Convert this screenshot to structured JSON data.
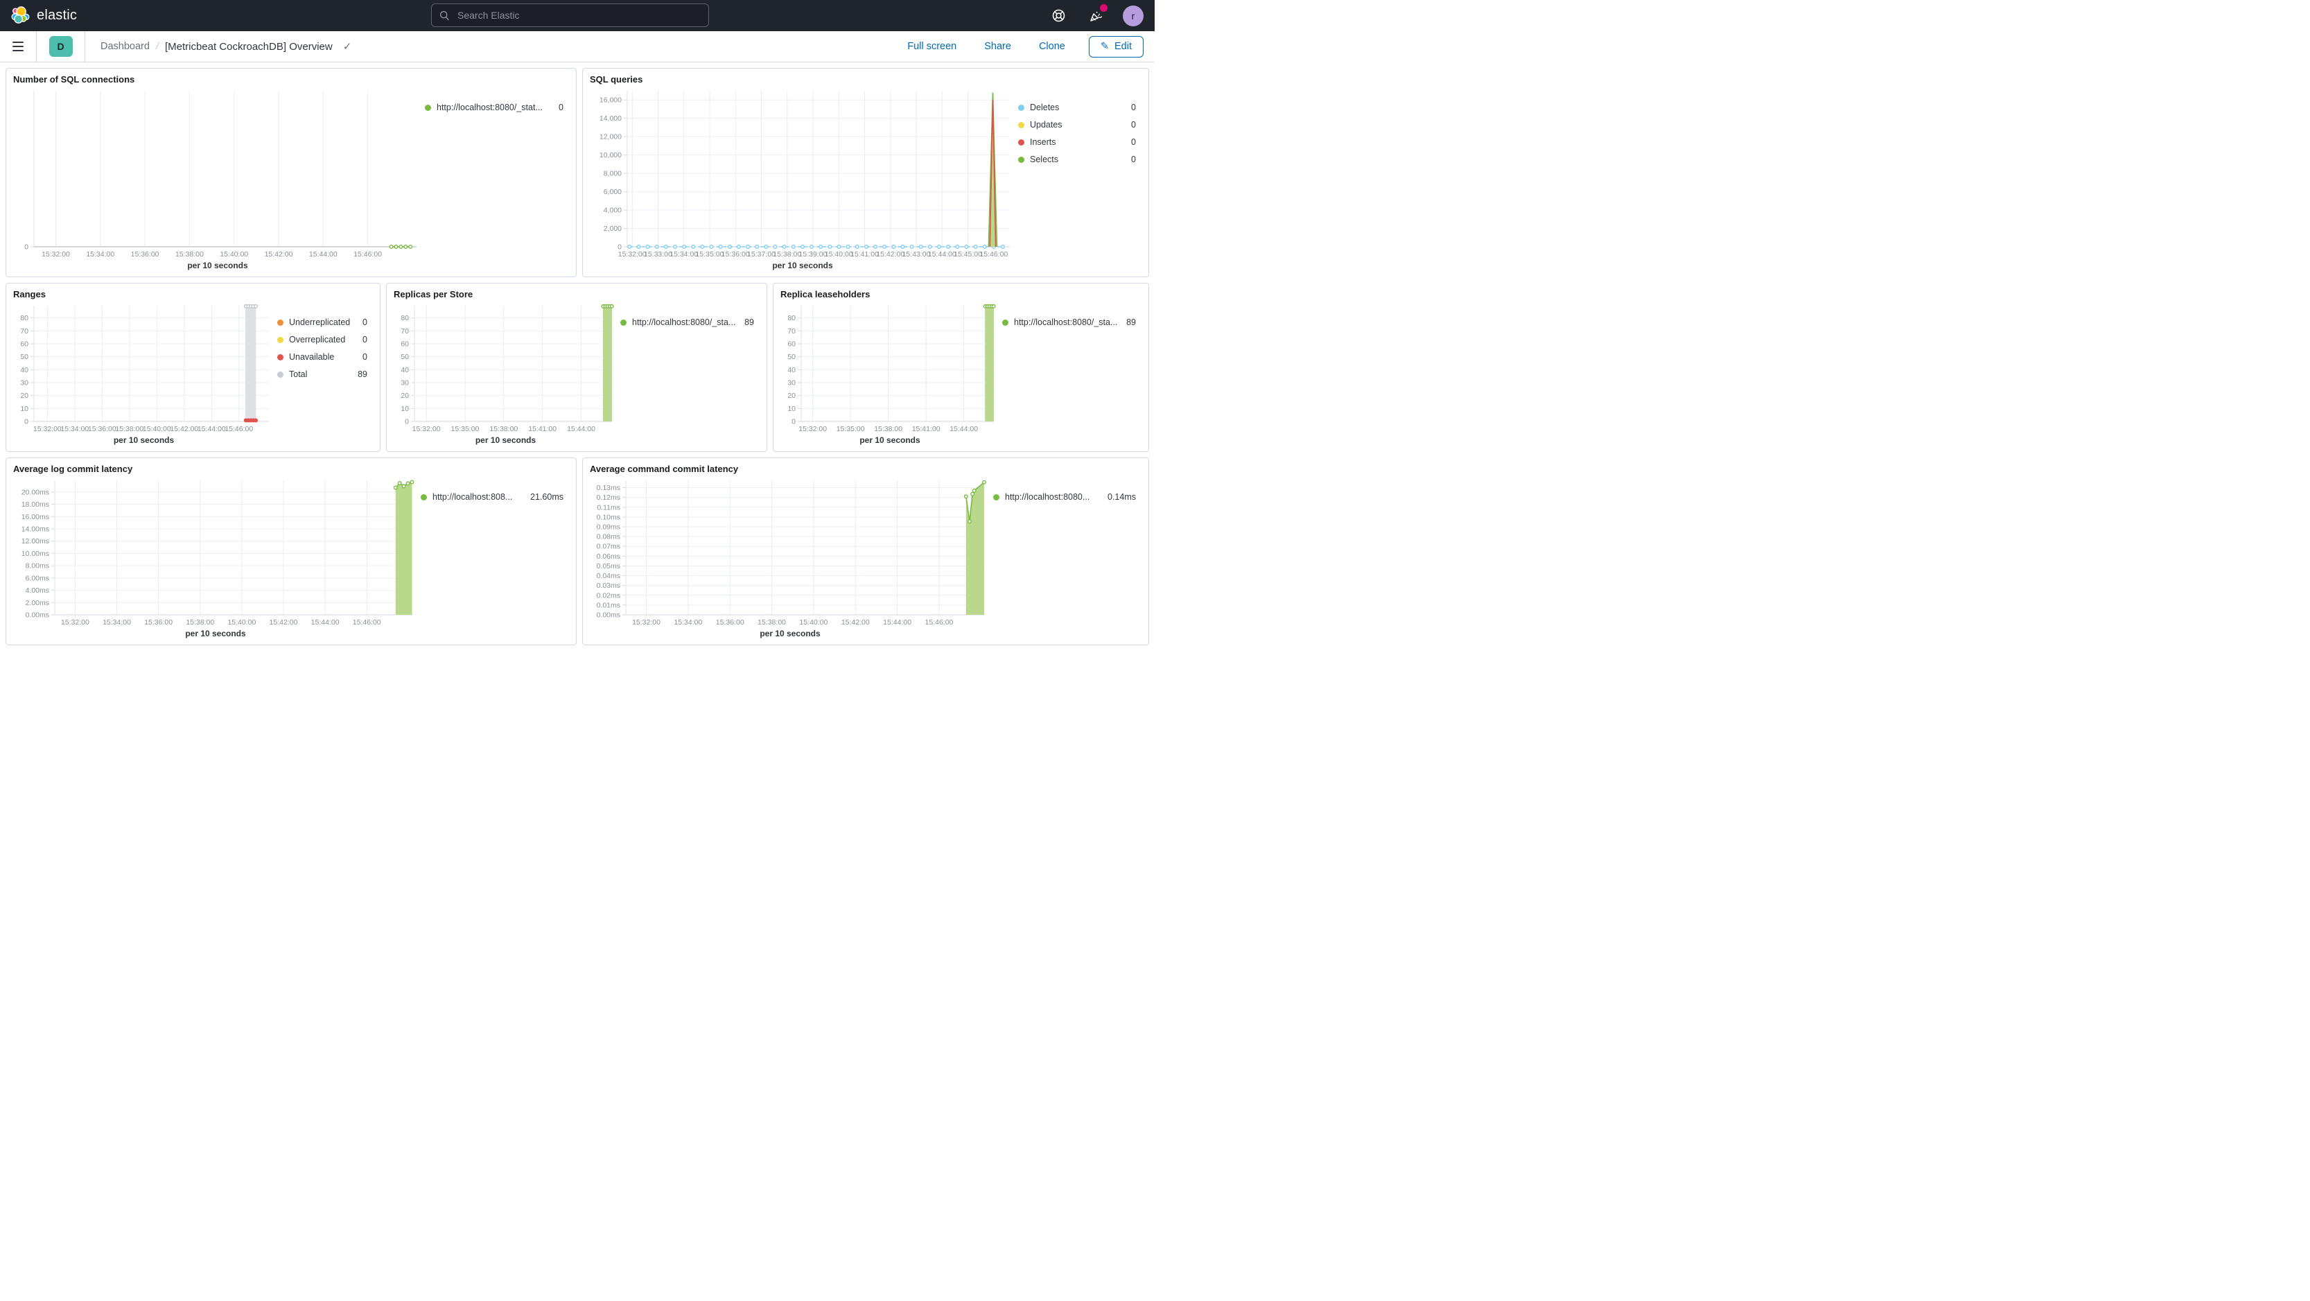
{
  "header": {
    "logo_text": "elastic",
    "search_placeholder": "Search Elastic",
    "avatar_initial": "r"
  },
  "toolbar": {
    "badge": "D",
    "breadcrumb_root": "Dashboard",
    "breadcrumb_sep": "/",
    "title": "[Metricbeat CockroachDB] Overview",
    "actions": [
      {
        "label": "Full screen"
      },
      {
        "label": "Share"
      },
      {
        "label": "Clone"
      }
    ],
    "edit_label": "Edit",
    "edit_icon": "✎",
    "title_check": "✓"
  },
  "colors": {
    "green": "#77BB41",
    "green_fill": "#B9D88C",
    "blue": "#7FCDF2",
    "yellow": "#F0D843",
    "red": "#E0524C",
    "orange": "#EF8E38",
    "grey_bar": "#DEE0E4",
    "link_blue": "#006bb4"
  },
  "panels": [
    {
      "title": "Number of SQL connections",
      "caption": "per 10 seconds",
      "legend": [
        {
          "color": "#77BB41",
          "label": "http://localhost:8080/_stat...",
          "value": "0"
        }
      ],
      "chart": {
        "ylim": [
          0,
          1
        ],
        "baseline": 2,
        "yticks": [
          {
            "v": 0,
            "label": "0"
          }
        ],
        "xticks": [
          {
            "f": 0.057,
            "label": "15:32:00"
          },
          {
            "f": 0.1735,
            "label": "15:34:00"
          },
          {
            "f": 0.29,
            "label": "15:36:00"
          },
          {
            "f": 0.4065,
            "label": "15:38:00"
          },
          {
            "f": 0.523,
            "label": "15:40:00"
          },
          {
            "f": 0.6395,
            "label": "15:42:00"
          },
          {
            "f": 0.756,
            "label": "15:44:00"
          },
          {
            "f": 0.8725,
            "label": "15:46:00"
          }
        ],
        "series": [
          {
            "type": "line",
            "color": "#77BB41",
            "markers": "hollow",
            "points": [
              [
                0.934,
                0
              ],
              [
                0.9465,
                0
              ],
              [
                0.959,
                0
              ],
              [
                0.9715,
                0
              ],
              [
                0.984,
                0
              ]
            ]
          }
        ]
      }
    },
    {
      "title": "SQL queries",
      "caption": "per 10 seconds",
      "legend": [
        {
          "color": "#7FCDF2",
          "label": "Deletes",
          "value": "0"
        },
        {
          "color": "#F0D843",
          "label": "Updates",
          "value": "0"
        },
        {
          "color": "#E0524C",
          "label": "Inserts",
          "value": "0"
        },
        {
          "color": "#77BB41",
          "label": "Selects",
          "value": "0"
        }
      ],
      "chart": {
        "ylim": [
          0,
          17000
        ],
        "yticks": [
          {
            "v": 0,
            "label": "0"
          },
          {
            "v": 2000,
            "label": "2,000"
          },
          {
            "v": 4000,
            "label": "4,000"
          },
          {
            "v": 6000,
            "label": "6,000"
          },
          {
            "v": 8000,
            "label": "8,000"
          },
          {
            "v": 10000,
            "label": "10,000"
          },
          {
            "v": 12000,
            "label": "12,000"
          },
          {
            "v": 14000,
            "label": "14,000"
          },
          {
            "v": 16000,
            "label": "16,000"
          }
        ],
        "xticks": [
          {
            "f": 0.013,
            "label": "15:32:00"
          },
          {
            "f": 0.0805,
            "label": "15:33:00"
          },
          {
            "f": 0.148,
            "label": "15:34:00"
          },
          {
            "f": 0.2155,
            "label": "15:35:00"
          },
          {
            "f": 0.283,
            "label": "15:36:00"
          },
          {
            "f": 0.3505,
            "label": "15:37:00"
          },
          {
            "f": 0.418,
            "label": "15:38:00"
          },
          {
            "f": 0.4855,
            "label": "15:39:00"
          },
          {
            "f": 0.553,
            "label": "15:40:00"
          },
          {
            "f": 0.6205,
            "label": "15:41:00"
          },
          {
            "f": 0.688,
            "label": "15:42:00"
          },
          {
            "f": 0.7555,
            "label": "15:43:00"
          },
          {
            "f": 0.823,
            "label": "15:44:00"
          },
          {
            "f": 0.8905,
            "label": "15:45:00"
          },
          {
            "f": 0.958,
            "label": "15:46:00"
          }
        ],
        "series": [
          {
            "type": "hline",
            "y": 0,
            "from": 0.006,
            "to": 0.985,
            "color": "#7FCDF2",
            "dashed": true,
            "markers": "hollow",
            "marker_step": 0.0238
          },
          {
            "type": "line",
            "color": "#77BB41",
            "fill": "#B9D88C",
            "points": [
              [
                0.9445,
                0
              ],
              [
                0.9555,
                16800
              ],
              [
                0.9665,
                0
              ]
            ]
          },
          {
            "type": "line",
            "color": "#E0524C",
            "points": [
              [
                0.948,
                0
              ],
              [
                0.9555,
                16000
              ],
              [
                0.963,
                0
              ]
            ]
          }
        ]
      }
    },
    {
      "title": "Ranges",
      "caption": "per 10 seconds",
      "legend": [
        {
          "color": "#EF8E38",
          "label": "Underreplicated",
          "value": "0"
        },
        {
          "color": "#F0D843",
          "label": "Overreplicated",
          "value": "0"
        },
        {
          "color": "#E0524C",
          "label": "Unavailable",
          "value": "0"
        },
        {
          "color": "#C9CDD3",
          "label": "Total",
          "value": "89"
        }
      ],
      "chart": {
        "ylim": [
          0,
          89.5
        ],
        "yticks": [
          {
            "v": 0,
            "label": "0"
          },
          {
            "v": 10,
            "label": "10"
          },
          {
            "v": 20,
            "label": "20"
          },
          {
            "v": 30,
            "label": "30"
          },
          {
            "v": 40,
            "label": "40"
          },
          {
            "v": 50,
            "label": "50"
          },
          {
            "v": 60,
            "label": "60"
          },
          {
            "v": 70,
            "label": "70"
          },
          {
            "v": 80,
            "label": "80"
          }
        ],
        "xticks": [
          {
            "f": 0.057,
            "label": "15:32:00"
          },
          {
            "f": 0.1735,
            "label": "15:34:00"
          },
          {
            "f": 0.29,
            "label": "15:36:00"
          },
          {
            "f": 0.4065,
            "label": "15:38:00"
          },
          {
            "f": 0.523,
            "label": "15:40:00"
          },
          {
            "f": 0.6395,
            "label": "15:42:00"
          },
          {
            "f": 0.756,
            "label": "15:44:00"
          },
          {
            "f": 0.8725,
            "label": "15:46:00"
          }
        ],
        "series": [
          {
            "type": "bar",
            "x0": 0.9,
            "x1": 0.945,
            "v": 89,
            "color": "#DEE0E4"
          },
          {
            "type": "markers",
            "marker": "hollow",
            "color": "#c2c5cb",
            "points": [
              [
                0.902,
                89
              ],
              [
                0.9125,
                89
              ],
              [
                0.923,
                89
              ],
              [
                0.9335,
                89
              ],
              [
                0.944,
                89
              ]
            ]
          },
          {
            "type": "markers",
            "marker": "filled",
            "color": "#E0524C",
            "points": [
              [
                0.902,
                0.8
              ],
              [
                0.9125,
                0.8
              ],
              [
                0.923,
                0.8
              ],
              [
                0.9335,
                0.8
              ],
              [
                0.944,
                0.8
              ]
            ]
          }
        ]
      }
    },
    {
      "title": "Replicas per Store",
      "caption": "per 10 seconds",
      "legend": [
        {
          "color": "#77BB41",
          "label": "http://localhost:8080/_sta...",
          "value": "89"
        }
      ],
      "chart": {
        "ylim": [
          0,
          89.5
        ],
        "yticks": [
          {
            "v": 0,
            "label": "0"
          },
          {
            "v": 10,
            "label": "10"
          },
          {
            "v": 20,
            "label": "20"
          },
          {
            "v": 30,
            "label": "30"
          },
          {
            "v": 40,
            "label": "40"
          },
          {
            "v": 50,
            "label": "50"
          },
          {
            "v": 60,
            "label": "60"
          },
          {
            "v": 70,
            "label": "70"
          },
          {
            "v": 80,
            "label": "80"
          }
        ],
        "xticks": [
          {
            "f": 0.06,
            "label": "15:32:00"
          },
          {
            "f": 0.256,
            "label": "15:35:00"
          },
          {
            "f": 0.452,
            "label": "15:38:00"
          },
          {
            "f": 0.648,
            "label": "15:41:00"
          },
          {
            "f": 0.844,
            "label": "15:44:00"
          }
        ],
        "series": [
          {
            "type": "line",
            "color": "#B9D88C",
            "fill": "#B9D88C",
            "points": [
              [
                0.954,
                89
              ],
              [
                1,
                89
              ]
            ]
          },
          {
            "type": "markers",
            "marker": "hollow",
            "color": "#77BB41",
            "points": [
              [
                0.956,
                89
              ],
              [
                0.967,
                89
              ],
              [
                0.978,
                89
              ],
              [
                0.989,
                89
              ],
              [
                0.999,
                89
              ]
            ]
          }
        ]
      }
    },
    {
      "title": "Replica leaseholders",
      "caption": "per 10 seconds",
      "legend": [
        {
          "color": "#77BB41",
          "label": "http://localhost:8080/_sta...",
          "value": "89"
        }
      ],
      "chart": {
        "ylim": [
          0,
          89.5
        ],
        "yticks": [
          {
            "v": 0,
            "label": "0"
          },
          {
            "v": 10,
            "label": "10"
          },
          {
            "v": 20,
            "label": "20"
          },
          {
            "v": 30,
            "label": "30"
          },
          {
            "v": 40,
            "label": "40"
          },
          {
            "v": 50,
            "label": "50"
          },
          {
            "v": 60,
            "label": "60"
          },
          {
            "v": 70,
            "label": "70"
          },
          {
            "v": 80,
            "label": "80"
          }
        ],
        "xticks": [
          {
            "f": 0.06,
            "label": "15:32:00"
          },
          {
            "f": 0.256,
            "label": "15:35:00"
          },
          {
            "f": 0.452,
            "label": "15:38:00"
          },
          {
            "f": 0.648,
            "label": "15:41:00"
          },
          {
            "f": 0.844,
            "label": "15:44:00"
          }
        ],
        "series": [
          {
            "type": "line",
            "color": "#B9D88C",
            "fill": "#B9D88C",
            "points": [
              [
                0.954,
                89
              ],
              [
                1,
                89
              ]
            ]
          },
          {
            "type": "markers",
            "marker": "hollow",
            "color": "#77BB41",
            "points": [
              [
                0.956,
                89
              ],
              [
                0.967,
                89
              ],
              [
                0.978,
                89
              ],
              [
                0.989,
                89
              ],
              [
                0.999,
                89
              ]
            ]
          }
        ]
      }
    },
    {
      "title": "Average log commit latency",
      "caption": "per 10 seconds",
      "legend": [
        {
          "color": "#77BB41",
          "label": "http://localhost:808...",
          "value": "21.60ms"
        }
      ],
      "chart": {
        "ylim": [
          0,
          21.9
        ],
        "yticks": [
          {
            "v": 0,
            "label": "0.00ms"
          },
          {
            "v": 2,
            "label": "2.00ms"
          },
          {
            "v": 4,
            "label": "4.00ms"
          },
          {
            "v": 6,
            "label": "6.00ms"
          },
          {
            "v": 8,
            "label": "8.00ms"
          },
          {
            "v": 10,
            "label": "10.00ms"
          },
          {
            "v": 12,
            "label": "12.00ms"
          },
          {
            "v": 14,
            "label": "14.00ms"
          },
          {
            "v": 16,
            "label": "16.00ms"
          },
          {
            "v": 18,
            "label": "18.00ms"
          },
          {
            "v": 20,
            "label": "20.00ms"
          }
        ],
        "xticks": [
          {
            "f": 0.057,
            "label": "15:32:00"
          },
          {
            "f": 0.1735,
            "label": "15:34:00"
          },
          {
            "f": 0.29,
            "label": "15:36:00"
          },
          {
            "f": 0.4065,
            "label": "15:38:00"
          },
          {
            "f": 0.523,
            "label": "15:40:00"
          },
          {
            "f": 0.6395,
            "label": "15:42:00"
          },
          {
            "f": 0.756,
            "label": "15:44:00"
          },
          {
            "f": 0.8725,
            "label": "15:46:00"
          }
        ],
        "series": [
          {
            "type": "line",
            "color": "#77BB41",
            "fill": "#B9D88C",
            "markers": "hollow",
            "points": [
              [
                0.953,
                20.7
              ],
              [
                0.9645,
                21.45
              ],
              [
                0.976,
                20.95
              ],
              [
                0.9875,
                21.4
              ],
              [
                0.999,
                21.6
              ]
            ]
          }
        ]
      }
    },
    {
      "title": "Average command commit latency",
      "caption": "per 10 seconds",
      "legend": [
        {
          "color": "#77BB41",
          "label": "http://localhost:8080...",
          "value": "0.14ms"
        }
      ],
      "chart": {
        "ylim": [
          0,
          0.1375
        ],
        "yticks": [
          {
            "v": 0,
            "label": "0.00ms"
          },
          {
            "v": 0.01,
            "label": "0.01ms"
          },
          {
            "v": 0.02,
            "label": "0.02ms"
          },
          {
            "v": 0.03,
            "label": "0.03ms"
          },
          {
            "v": 0.04,
            "label": "0.04ms"
          },
          {
            "v": 0.05,
            "label": "0.05ms"
          },
          {
            "v": 0.06,
            "label": "0.06ms"
          },
          {
            "v": 0.07,
            "label": "0.07ms"
          },
          {
            "v": 0.08,
            "label": "0.08ms"
          },
          {
            "v": 0.09,
            "label": "0.09ms"
          },
          {
            "v": 0.1,
            "label": "0.10ms"
          },
          {
            "v": 0.11,
            "label": "0.11ms"
          },
          {
            "v": 0.12,
            "label": "0.12ms"
          },
          {
            "v": 0.13,
            "label": "0.13ms"
          }
        ],
        "xticks": [
          {
            "f": 0.057,
            "label": "15:32:00"
          },
          {
            "f": 0.1735,
            "label": "15:34:00"
          },
          {
            "f": 0.29,
            "label": "15:36:00"
          },
          {
            "f": 0.4065,
            "label": "15:38:00"
          },
          {
            "f": 0.523,
            "label": "15:40:00"
          },
          {
            "f": 0.6395,
            "label": "15:42:00"
          },
          {
            "f": 0.756,
            "label": "15:44:00"
          },
          {
            "f": 0.8725,
            "label": "15:46:00"
          }
        ],
        "series": [
          {
            "type": "line",
            "color": "#77BB41",
            "fill": "#B9D88C",
            "markers": "hollow",
            "points": [
              [
                0.9475,
                0.121
              ],
              [
                0.9575,
                0.0955
              ],
              [
                0.9655,
                0.1235
              ],
              [
                0.9705,
                0.127
              ],
              [
                0.998,
                0.1355
              ]
            ]
          }
        ]
      }
    }
  ]
}
